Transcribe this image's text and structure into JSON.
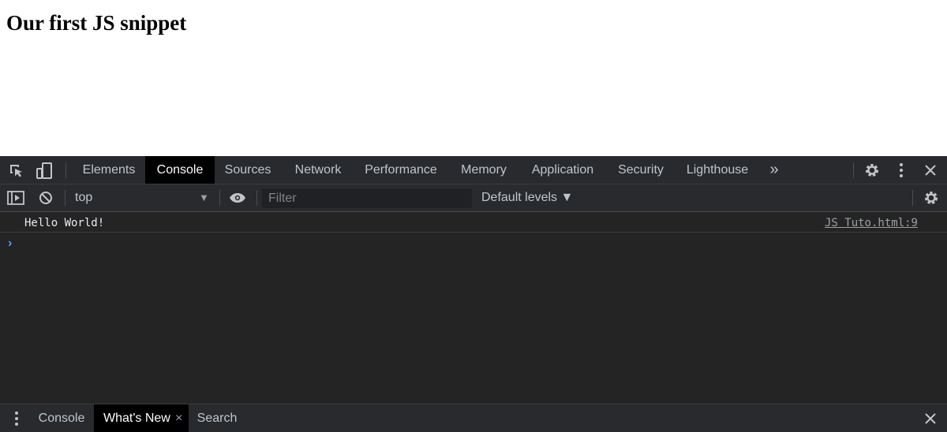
{
  "page": {
    "heading": "Our first JS snippet"
  },
  "devtools": {
    "tabs": [
      {
        "label": "Elements",
        "active": false
      },
      {
        "label": "Console",
        "active": true
      },
      {
        "label": "Sources",
        "active": false
      },
      {
        "label": "Network",
        "active": false
      },
      {
        "label": "Performance",
        "active": false
      },
      {
        "label": "Memory",
        "active": false
      },
      {
        "label": "Application",
        "active": false
      },
      {
        "label": "Security",
        "active": false
      },
      {
        "label": "Lighthouse",
        "active": false
      }
    ],
    "more_tabs_glyph": "»",
    "toolbar": {
      "context": "top",
      "filter_placeholder": "Filter",
      "filter_value": "",
      "levels": "Default levels ▼"
    },
    "console": {
      "messages": [
        {
          "text": "Hello World!",
          "source": "JS Tuto.html:9"
        }
      ],
      "prompt": "›"
    },
    "drawer": {
      "tabs": [
        {
          "label": "Console",
          "active": false
        },
        {
          "label": "What's New",
          "active": true,
          "closable": true
        },
        {
          "label": "Search",
          "active": false
        }
      ],
      "close_glyph": "×"
    },
    "colors": {
      "panel_bg": "#242424",
      "bar_bg": "#292a2d",
      "active_tab_bg": "#000000",
      "prompt_blue": "#4e9cff"
    }
  }
}
